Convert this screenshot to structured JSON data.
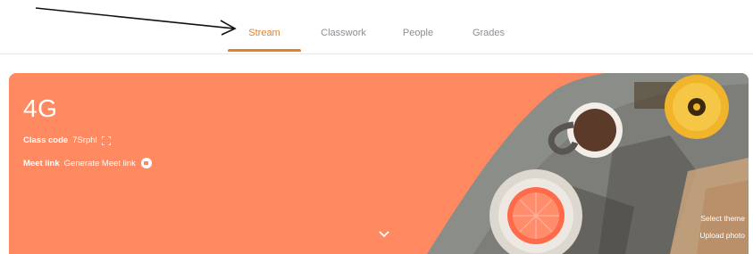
{
  "nav": {
    "tabs": [
      {
        "label": "Stream",
        "active": true
      },
      {
        "label": "Classwork",
        "active": false
      },
      {
        "label": "People",
        "active": false
      },
      {
        "label": "Grades",
        "active": false
      }
    ],
    "accent_color": "#e5812a"
  },
  "banner": {
    "background_color": "#ff8a61",
    "class_name": "4G",
    "class_code_label": "Class code",
    "class_code_value": "7Srphl",
    "meet_link_label": "Meet link",
    "meet_link_value": "Generate Meet link",
    "select_theme": "Select theme",
    "upload_photo": "Upload photo"
  },
  "icons": [
    "fullscreen-icon",
    "video-icon",
    "chevron-down-icon",
    "arrow-pointer"
  ]
}
